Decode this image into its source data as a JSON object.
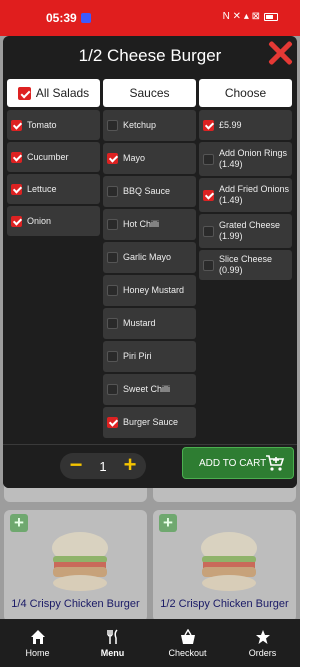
{
  "status": {
    "time": "05:39",
    "icons": "N ✕ ▴ ⊠"
  },
  "modal": {
    "title": "1/2 Cheese Burger",
    "salads": {
      "header": "All Salads",
      "header_checked": true,
      "items": [
        {
          "label": "Tomato",
          "checked": true
        },
        {
          "label": "Cucumber",
          "checked": true
        },
        {
          "label": "Lettuce",
          "checked": true
        },
        {
          "label": "Onion",
          "checked": true
        }
      ]
    },
    "sauces": {
      "header": "Sauces",
      "items": [
        {
          "label": "Ketchup",
          "checked": false
        },
        {
          "label": "Mayo",
          "checked": true
        },
        {
          "label": "BBQ Sauce",
          "checked": false
        },
        {
          "label": "Hot Chilli",
          "checked": false
        },
        {
          "label": "Garlic Mayo",
          "checked": false
        },
        {
          "label": "Honey Mustard",
          "checked": false
        },
        {
          "label": "Mustard",
          "checked": false
        },
        {
          "label": "Piri Piri",
          "checked": false
        },
        {
          "label": "Sweet Chilli",
          "checked": false
        },
        {
          "label": "Burger Sauce",
          "checked": true
        }
      ]
    },
    "choose": {
      "header": "Choose",
      "items": [
        {
          "label": "£5.99",
          "checked": true
        },
        {
          "label": "Add Onion Rings (1.49)",
          "checked": false
        },
        {
          "label": "Add Fried Onions (1.49)",
          "checked": true
        },
        {
          "label": "Grated Cheese (1.99)",
          "checked": false
        },
        {
          "label": "Slice Cheese (0.99)",
          "checked": false
        }
      ]
    },
    "quantity": "1",
    "minus": "−",
    "plus": "+",
    "add_to_cart": "ADD TO CART"
  },
  "background": {
    "cards": [
      {
        "title": "1/4 Crispy Chicken Burger",
        "plus": "+"
      },
      {
        "title": "1/2 Crispy Chicken Burger",
        "plus": "+"
      }
    ]
  },
  "nav": [
    {
      "label": "Home",
      "icon": "home-icon",
      "active": false
    },
    {
      "label": "Menu",
      "icon": "menu-icon",
      "active": true
    },
    {
      "label": "Checkout",
      "icon": "basket-icon",
      "active": false
    },
    {
      "label": "Orders",
      "icon": "star-icon",
      "active": false
    }
  ],
  "colors": {
    "status_bar": "#e01e1e",
    "modal_bg": "#1e1e1e",
    "checkbox_on": "#dd2222",
    "add_cart": "#2e7d32",
    "qty_accent": "#f5c400"
  }
}
